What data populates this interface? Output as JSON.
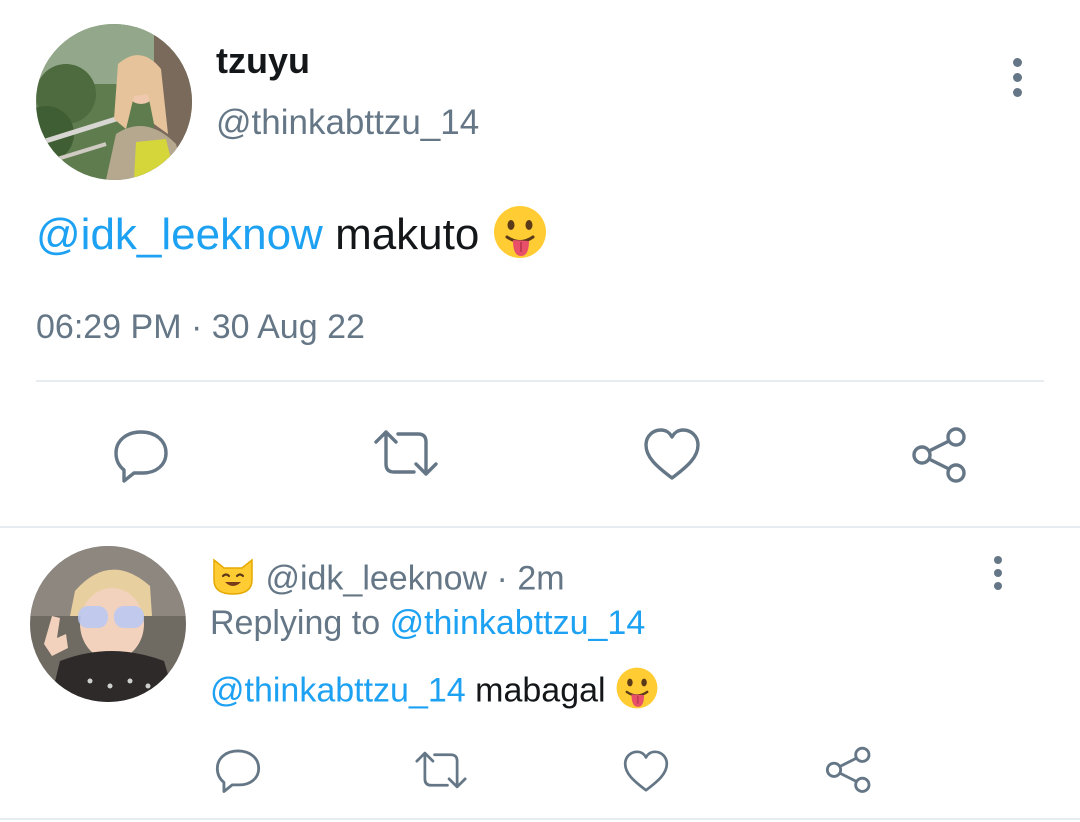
{
  "main_tweet": {
    "display_name": "tzuyu",
    "handle": "@thinkabttzu_14",
    "mention": "@idk_leeknow",
    "text": "makuto",
    "emoji": "tongue-out-emoji",
    "timestamp": "06:29 PM · 30 Aug 22",
    "actions": [
      "reply-icon",
      "retweet-icon",
      "like-icon",
      "share-icon"
    ]
  },
  "reply": {
    "name_emoji": "cat-face-emoji",
    "handle": "@idk_leeknow",
    "time_sep": "·",
    "time": "2m",
    "replying_label": "Replying to",
    "replying_to": "@thinkabttzu_14",
    "mention": "@thinkabttzu_14",
    "text": "mabagal",
    "emoji": "tongue-out-emoji",
    "actions": [
      "reply-icon",
      "retweet-icon",
      "like-icon",
      "share-icon"
    ]
  },
  "colors": {
    "link": "#1da1f2",
    "text": "#14171a",
    "muted": "#657786",
    "divider": "#e6ecf0"
  }
}
